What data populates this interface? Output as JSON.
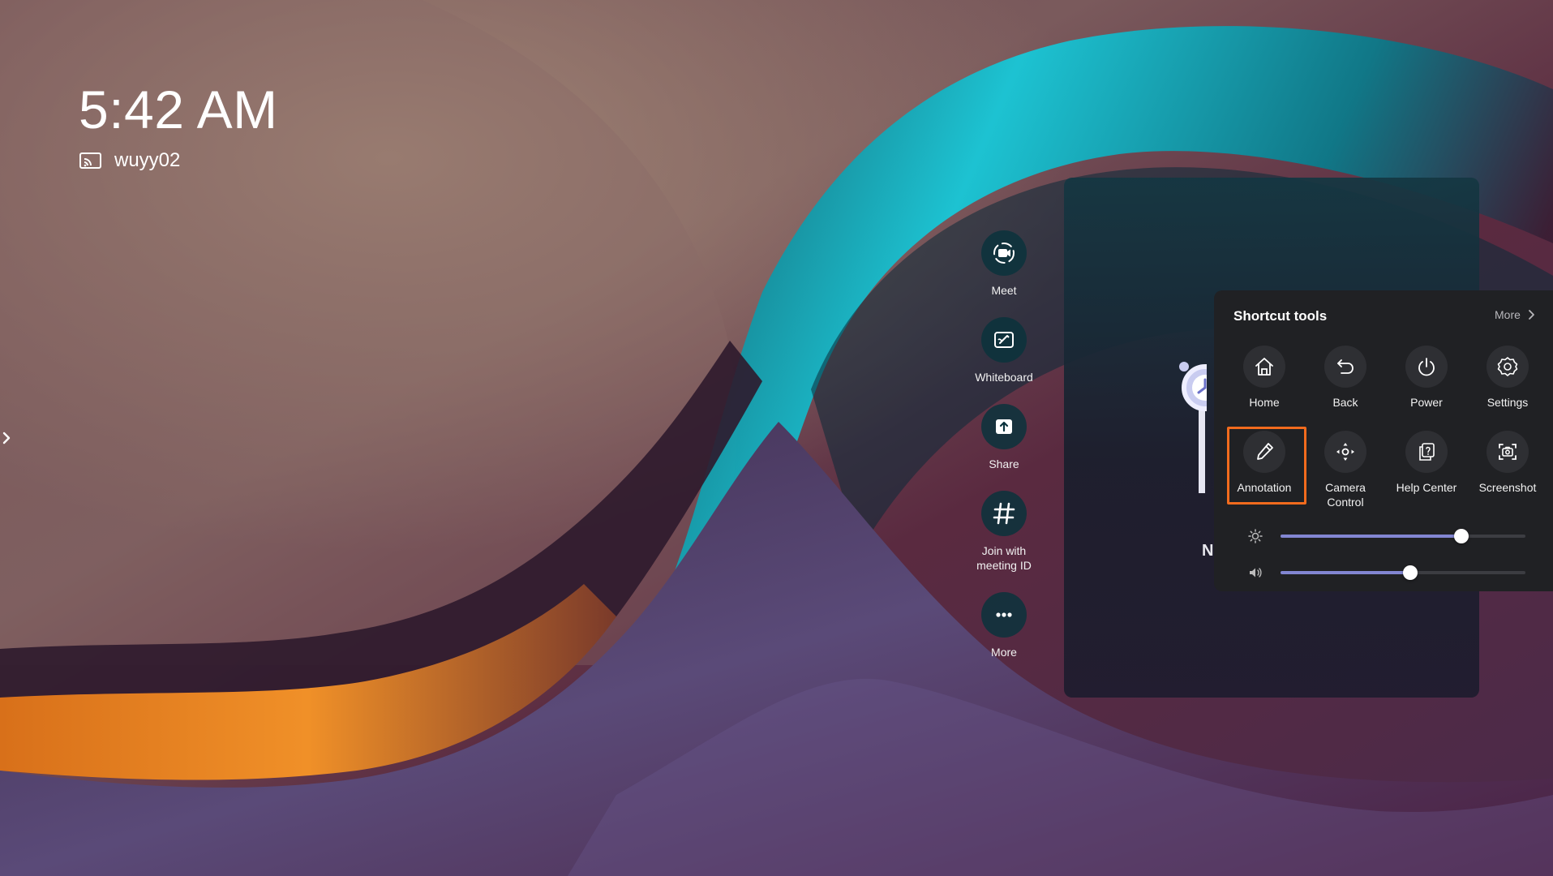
{
  "status": {
    "time": "5:42 AM",
    "device_name": "wuyy02",
    "device_icon": "cast-icon"
  },
  "dock": {
    "items": [
      {
        "label": "Meet",
        "icon": "video-camera-icon"
      },
      {
        "label": "Whiteboard",
        "icon": "whiteboard-icon"
      },
      {
        "label": "Share",
        "icon": "share-upload-icon"
      },
      {
        "label": "Join with\nmeeting ID",
        "icon": "hash-icon"
      },
      {
        "label": "More",
        "icon": "more-dots-icon"
      }
    ]
  },
  "card": {
    "visible_letter": "N"
  },
  "shortcut_tools": {
    "title": "Shortcut tools",
    "more_label": "More",
    "tiles": [
      {
        "label": "Home",
        "icon": "home-icon"
      },
      {
        "label": "Back",
        "icon": "back-arrow-icon"
      },
      {
        "label": "Power",
        "icon": "power-icon"
      },
      {
        "label": "Settings",
        "icon": "gear-icon"
      },
      {
        "label": "Annotation",
        "icon": "pencil-icon",
        "highlighted": true
      },
      {
        "label": "Camera\nControl",
        "icon": "camera-control-icon"
      },
      {
        "label": "Help Center",
        "icon": "help-center-icon"
      },
      {
        "label": "Screenshot",
        "icon": "screenshot-icon"
      }
    ],
    "brightness": {
      "icon": "brightness-icon",
      "level": 0.74
    },
    "volume": {
      "icon": "volume-icon",
      "level": 0.53
    }
  },
  "colors": {
    "highlight": "#f26b1d",
    "slider_fill": "#8286d2",
    "panel_bg": "#202124",
    "dock_circle": "#0a323c"
  }
}
